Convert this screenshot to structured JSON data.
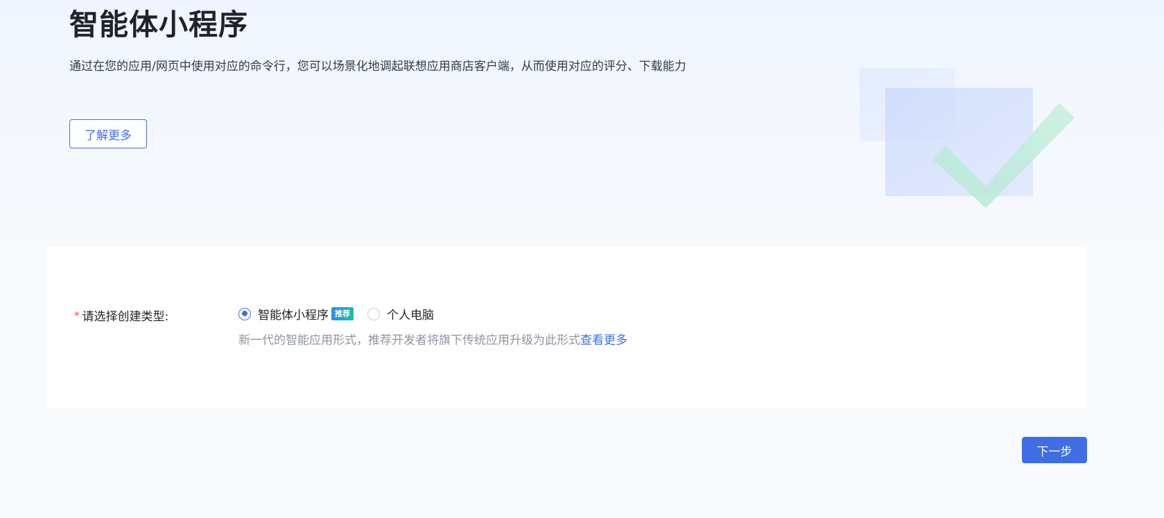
{
  "hero": {
    "title": "智能体小程序",
    "description": "通过在您的应用/网页中使用对应的命令行，您可以场景化地调起联想应用商店客户端，从而使用对应的评分、下载能力",
    "learn_more_label": "了解更多"
  },
  "form": {
    "label": "请选择创建类型:",
    "required_mark": "*",
    "options": [
      {
        "label": "智能体小程序",
        "badge": "推荐",
        "checked": true
      },
      {
        "label": "个人电脑",
        "checked": false
      }
    ],
    "hint_text": "新一代的智能应用形式，推荐开发者将旗下传统应用升级为此形式",
    "hint_link": "查看更多"
  },
  "actions": {
    "next_label": "下一步"
  },
  "colors": {
    "primary": "#3f6de4",
    "required": "#f5483b",
    "badge_start": "#2c8cf0",
    "badge_end": "#17c3a3"
  },
  "icons": {
    "illustration": "checkmark-illustration-icon"
  }
}
